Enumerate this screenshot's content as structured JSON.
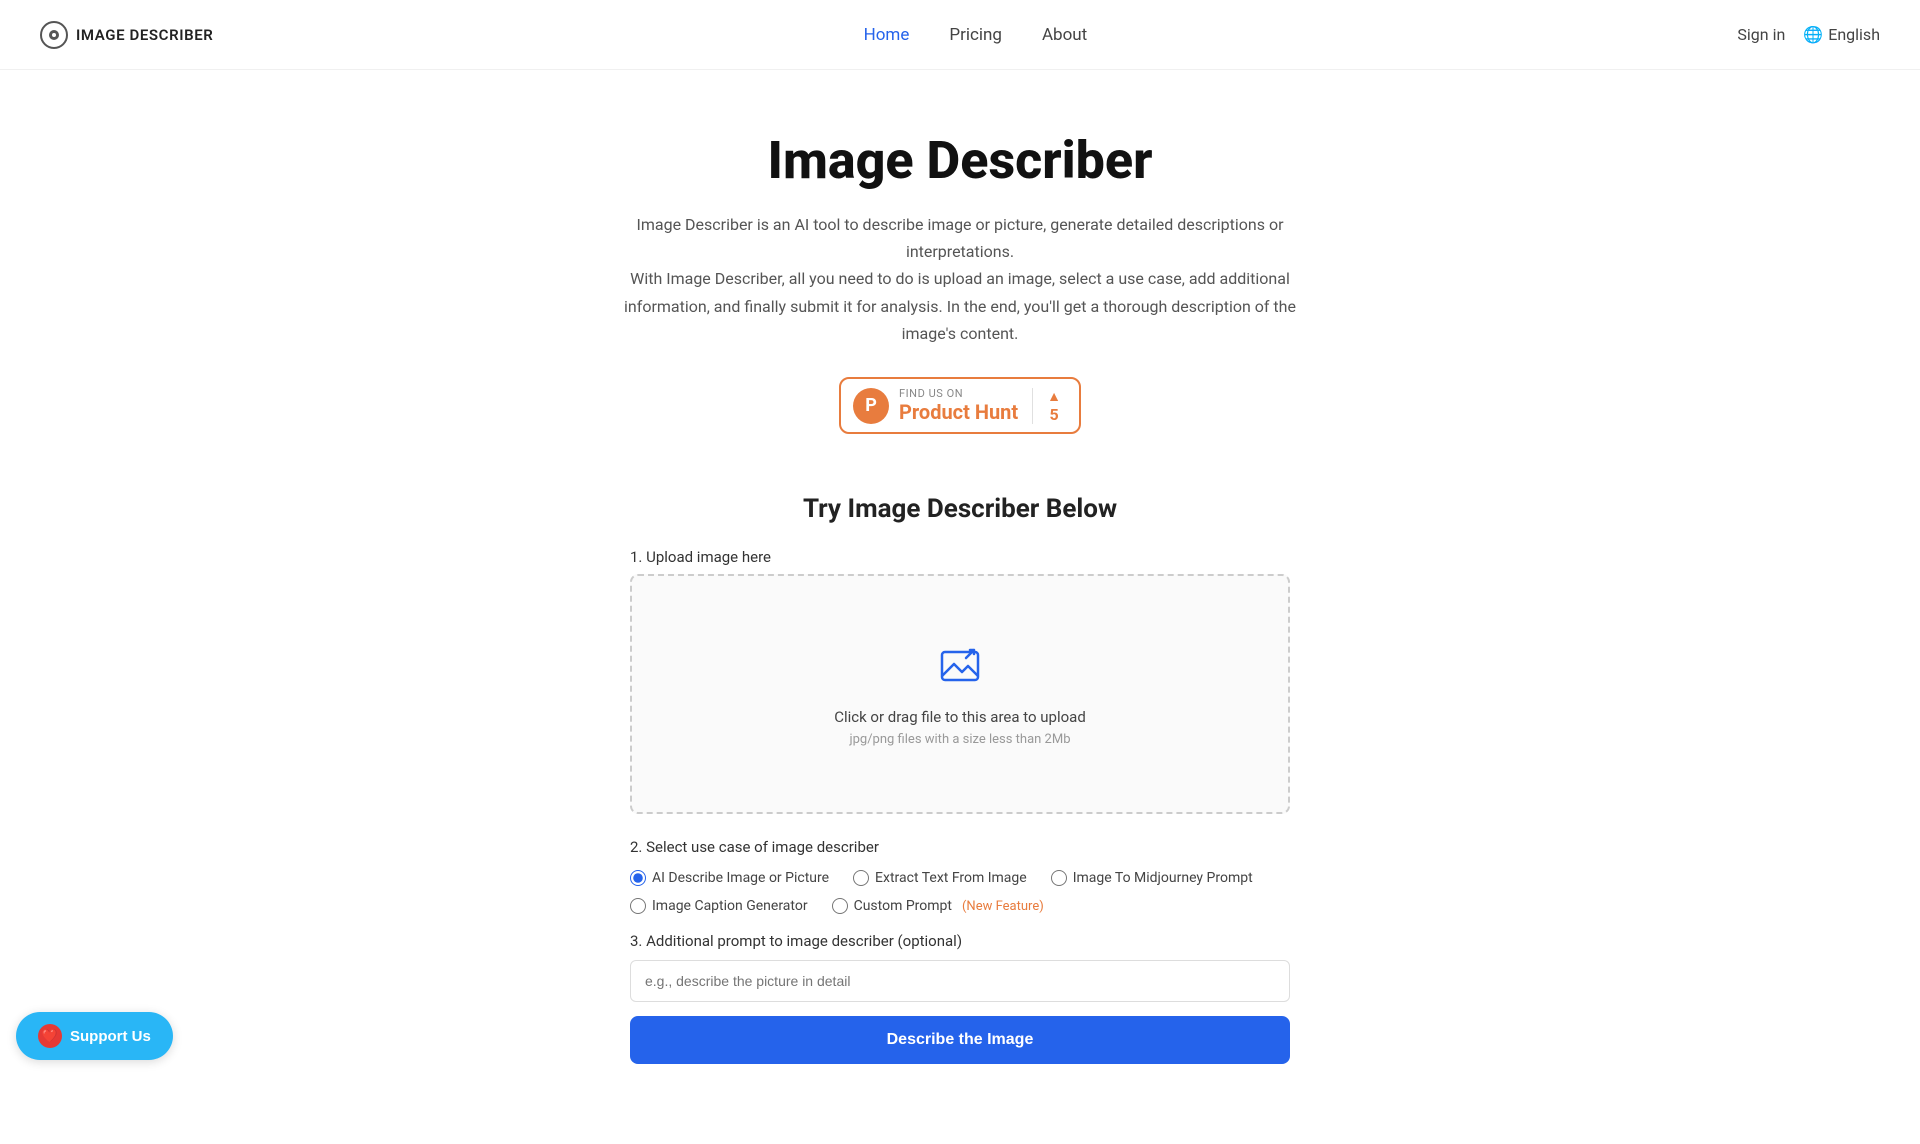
{
  "header": {
    "logo_text": "IMAGE DESCRIBER",
    "nav": {
      "home": "Home",
      "pricing": "Pricing",
      "about": "About"
    },
    "sign_in": "Sign in",
    "language": "English"
  },
  "hero": {
    "title": "Image Describer",
    "description_line1": "Image Describer is an AI tool to describe image or picture, generate detailed descriptions or interpretations.",
    "description_line2": "With Image Describer, all you need to do is upload an image, select a use case, add additional information, and finally submit it for analysis. In the end, you'll get a thorough description of the image's content.",
    "product_hunt": {
      "find_us": "FIND US ON",
      "name": "Product Hunt",
      "score": "5"
    }
  },
  "main": {
    "section_title": "Try Image Describer Below",
    "upload": {
      "label": "1. Upload image here",
      "primary": "Click or drag file to this area to upload",
      "secondary": "jpg/png files with a size less than 2Mb"
    },
    "use_case": {
      "label": "2. Select use case of image describer",
      "options": [
        {
          "id": "ai-describe",
          "label": "AI Describe Image or Picture",
          "checked": true
        },
        {
          "id": "extract-text",
          "label": "Extract Text From Image",
          "checked": false
        },
        {
          "id": "midjourney",
          "label": "Image To Midjourney Prompt",
          "checked": false
        },
        {
          "id": "caption",
          "label": "Image Caption Generator",
          "checked": false
        },
        {
          "id": "custom",
          "label": "Custom Prompt",
          "checked": false,
          "badge": "(New Feature)"
        }
      ]
    },
    "additional": {
      "label": "3. Additional prompt to image describer (optional)",
      "placeholder": "e.g., describe the picture in detail"
    },
    "submit_button": "Describe the Image"
  },
  "support": {
    "label": "Support Us"
  }
}
